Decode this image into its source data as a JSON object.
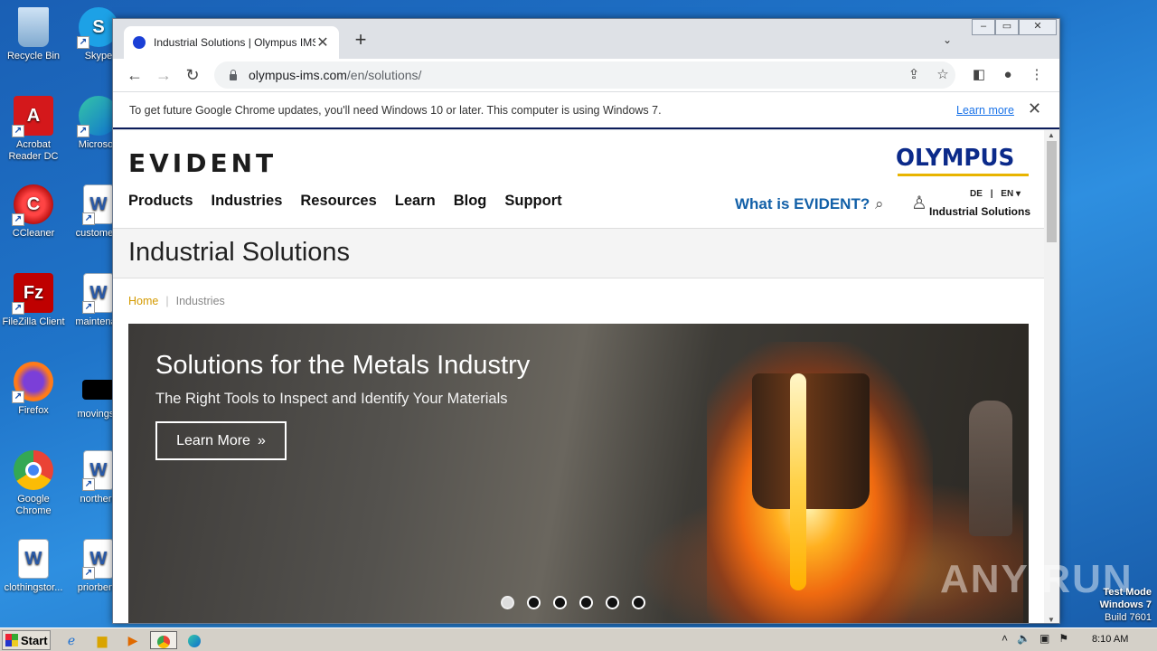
{
  "desktop": {
    "icons": [
      {
        "label": "Recycle Bin"
      },
      {
        "label": "Skype"
      },
      {
        "label": "Acrobat Reader DC"
      },
      {
        "label": "Microsoft"
      },
      {
        "label": "CCleaner"
      },
      {
        "label": "customers"
      },
      {
        "label": "FileZilla Client"
      },
      {
        "label": "maintenan"
      },
      {
        "label": "Firefox"
      },
      {
        "label": "movingsu"
      },
      {
        "label": "Google Chrome"
      },
      {
        "label": "northern"
      },
      {
        "label": "clothingstor..."
      },
      {
        "label": "priorbene"
      }
    ],
    "watermark": "ANY RUN",
    "test_mode": {
      "line1": "Test Mode",
      "line2": "Windows 7",
      "line3": "Build 7601"
    }
  },
  "browser": {
    "tab_title": "Industrial Solutions | Olympus IMS",
    "url_host": "olympus-ims.com",
    "url_path": "/en/solutions/",
    "infobar_message": "To get future Google Chrome updates, you'll need Windows 10 or later. This computer is using Windows 7.",
    "infobar_link": "Learn more"
  },
  "page": {
    "logo_evident": "EVIDENT",
    "logo_olympus": "OLYMPUS",
    "nav": [
      "Products",
      "Industries",
      "Resources",
      "Learn",
      "Blog",
      "Support"
    ],
    "what_is": "What is EVIDENT?",
    "lang": {
      "de": "DE",
      "sep": "|",
      "en": "EN"
    },
    "site_label": "Industrial Solutions",
    "title": "Industrial Solutions",
    "breadcrumb": {
      "home": "Home",
      "sep": "|",
      "current": "Industries"
    },
    "hero": {
      "heading": "Solutions for the Metals Industry",
      "subheading": "The Right Tools to Inspect and Identify Your Materials",
      "button": "Learn More"
    }
  },
  "taskbar": {
    "start": "Start",
    "clock": "8:10 AM"
  }
}
